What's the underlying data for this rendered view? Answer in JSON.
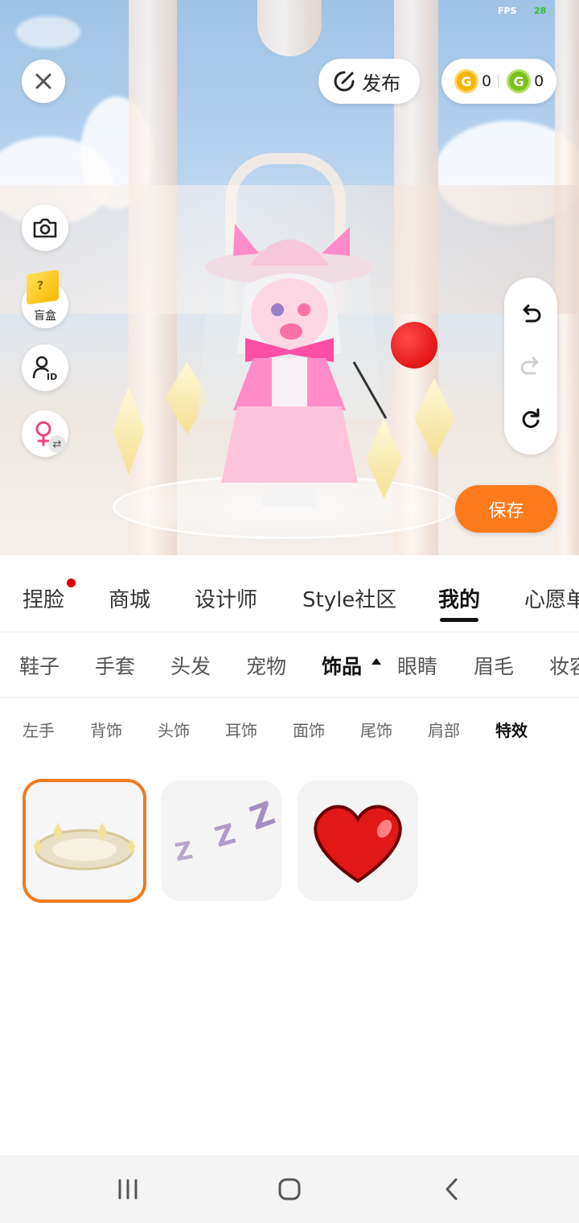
{
  "status": {
    "fps_label": "FPS",
    "fps_value": "28"
  },
  "topbar": {
    "publish_label": "发布",
    "coin_gold": "0",
    "coin_green": "0"
  },
  "side": {
    "blind_box_label": "盲盒"
  },
  "save_label": "保存",
  "main_tabs": [
    "捏脸",
    "商城",
    "设计师",
    "Style社区",
    "我的",
    "心愿单"
  ],
  "main_tabs_active": "我的",
  "category_tabs": [
    "鞋子",
    "手套",
    "头发",
    "宠物",
    "饰品",
    "眼睛",
    "眉毛",
    "妆容"
  ],
  "category_tabs_active": "饰品",
  "sub_tabs": [
    "左手",
    "背饰",
    "头饰",
    "耳饰",
    "面饰",
    "尾饰",
    "肩部",
    "特效"
  ],
  "sub_tabs_active": "特效",
  "items": [
    {
      "icon": "sparkle-ring-effect-icon",
      "selected": true
    },
    {
      "icon": "sleep-zzz-effect-icon",
      "selected": false
    },
    {
      "icon": "heart-effect-icon",
      "selected": false
    }
  ],
  "icons": {
    "close": "close-icon",
    "publish": "publish-icon",
    "camera": "camera-icon",
    "blind_box": "blind-box-icon",
    "profile_id": "profile-id-icon",
    "gender": "female-icon",
    "undo": "undo-icon",
    "redo": "redo-icon",
    "reset": "reset-icon"
  },
  "colors": {
    "accent": "#ff7a1a",
    "selected_border": "#f07a1e",
    "notification_dot": "#e00000"
  }
}
